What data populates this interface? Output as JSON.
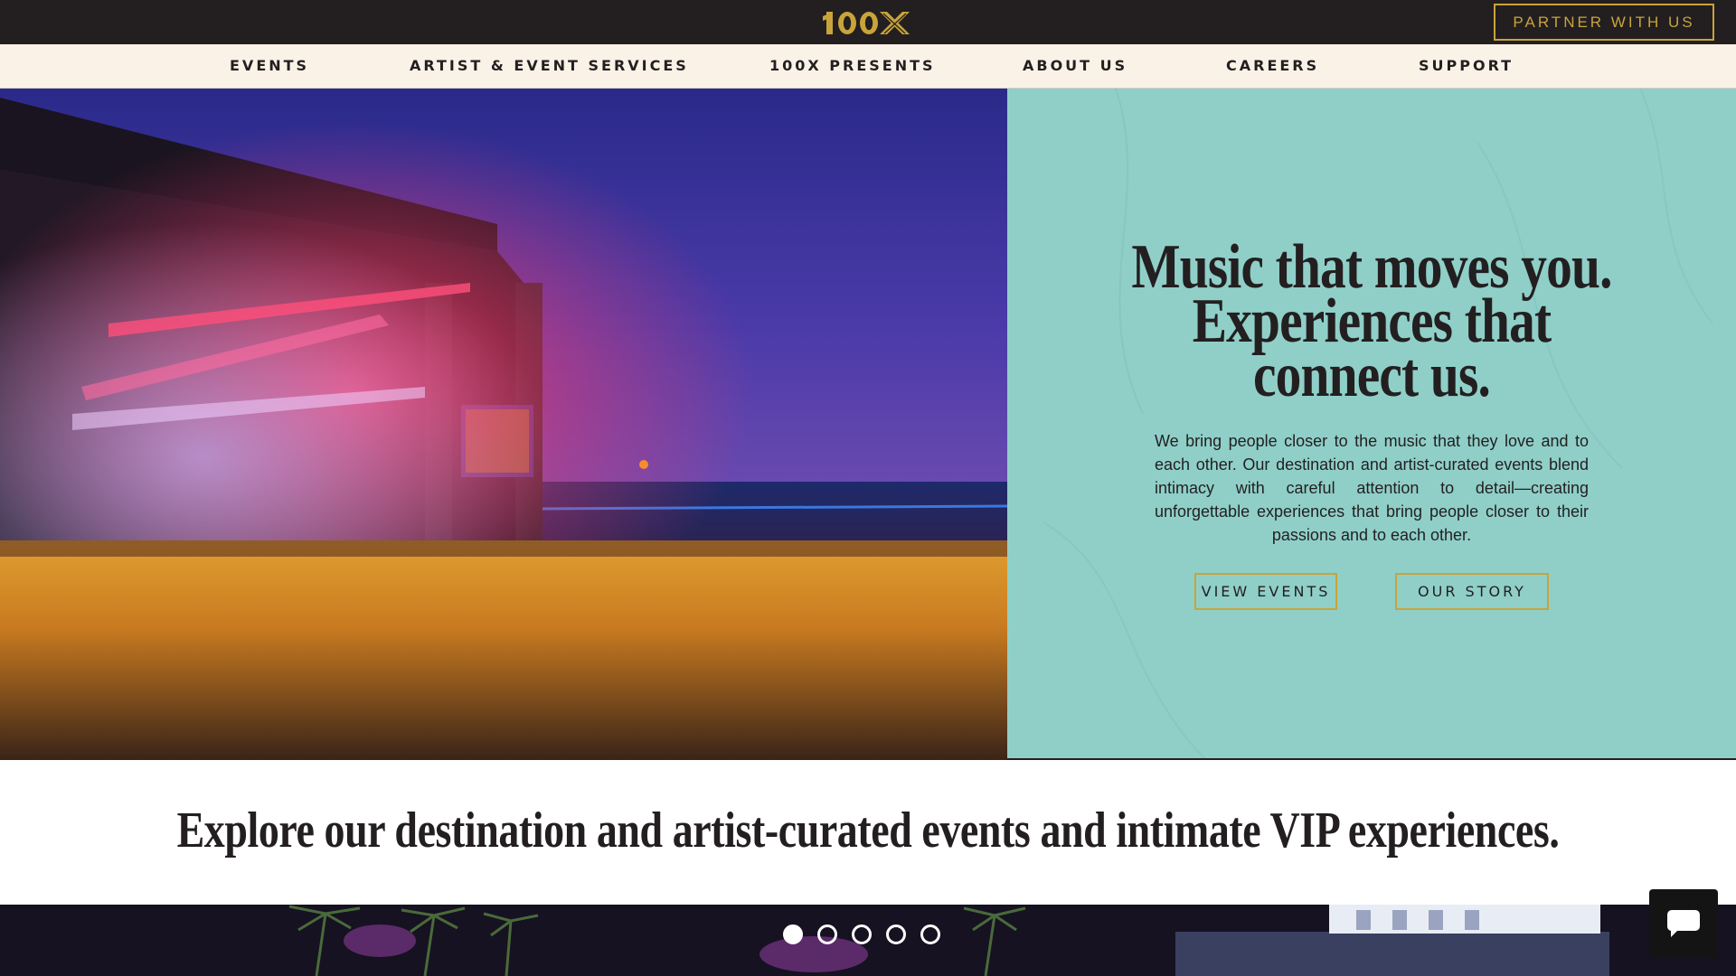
{
  "brand": {
    "logo_text": "100X",
    "partner_button": "PARTNER WITH US",
    "colors": {
      "gold": "#c8a43a",
      "dark": "#231f20",
      "teal": "#8fcfc8",
      "cream": "#fbf2e7"
    }
  },
  "nav": {
    "items": [
      {
        "label": "EVENTS"
      },
      {
        "label": "ARTIST & EVENT SERVICES"
      },
      {
        "label": "100X PRESENTS"
      },
      {
        "label": "ABOUT US"
      },
      {
        "label": "CAREERS"
      },
      {
        "label": "SUPPORT"
      }
    ]
  },
  "hero": {
    "headline_lines": [
      "Music that moves you.",
      "Experiences that",
      "connect us."
    ],
    "description": "We bring people closer to the music that they love and to each other. Our destination and artist-curated events blend intimacy with careful attention to detail—creating unforgettable experiences that bring people closer to their passions and to each other.",
    "buttons": {
      "view_events": "VIEW EVENTS",
      "our_story": "OUR STORY"
    }
  },
  "explore": {
    "heading": "Explore our destination and artist-curated events and intimate VIP experiences."
  },
  "carousel": {
    "slide_count": 5,
    "active_slide": 1
  },
  "icons": {
    "chat": "chat-bubble-icon"
  }
}
